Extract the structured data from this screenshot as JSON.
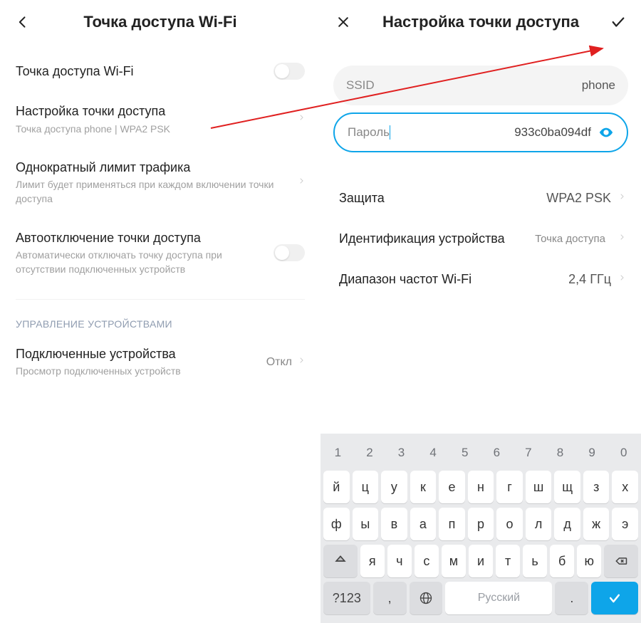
{
  "left": {
    "title": "Точка доступа Wi-Fi",
    "rows": {
      "hotspot": {
        "label": "Точка доступа Wi-Fi"
      },
      "configure": {
        "label": "Настройка точки доступа",
        "sub": "Точка доступа phone | WPA2 PSK"
      },
      "limit": {
        "label": "Однократный лимит трафика",
        "sub": "Лимит будет применяться при каждом включении точки доступа"
      },
      "autooff": {
        "label": "Автоотключение точки доступа",
        "sub": "Автоматически отключать точку доступа при отсутствии подключенных устройств"
      }
    },
    "section": "УПРАВЛЕНИЕ УСТРОЙСТВАМИ",
    "connected": {
      "label": "Подключенные устройства",
      "sub": "Просмотр подключенных устройств",
      "value": "Откл"
    }
  },
  "right": {
    "title": "Настройка точки доступа",
    "ssid": {
      "label": "SSID",
      "value": "phone"
    },
    "password": {
      "label": "Пароль",
      "value": "933c0ba094df"
    },
    "security": {
      "label": "Защита",
      "value": "WPA2 PSK"
    },
    "ident": {
      "label": "Идентификация устройства",
      "value": "Точка доступа"
    },
    "band": {
      "label": "Диапазон частот Wi-Fi",
      "value": "2,4 ГГц"
    }
  },
  "keyboard": {
    "nums": [
      "1",
      "2",
      "3",
      "4",
      "5",
      "6",
      "7",
      "8",
      "9",
      "0"
    ],
    "r1": [
      "й",
      "ц",
      "у",
      "к",
      "е",
      "н",
      "г",
      "ш",
      "щ",
      "з",
      "х"
    ],
    "r2": [
      "ф",
      "ы",
      "в",
      "а",
      "п",
      "р",
      "о",
      "л",
      "д",
      "ж",
      "э"
    ],
    "r3": [
      "я",
      "ч",
      "с",
      "м",
      "и",
      "т",
      "ь",
      "б",
      "ю"
    ],
    "opt": "?123",
    "space": "Русский"
  }
}
